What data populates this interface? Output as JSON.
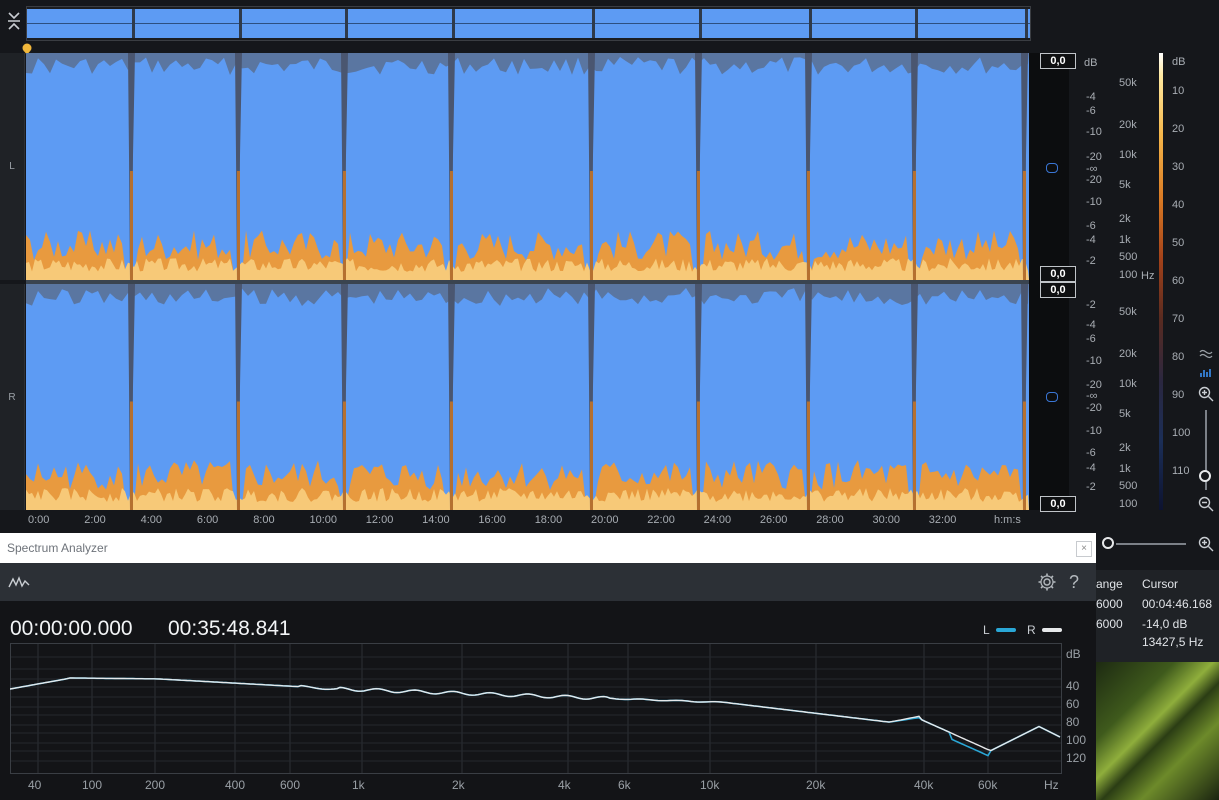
{
  "overview": {
    "collapse_icon": "collapse-icon"
  },
  "channels": {
    "left": "L",
    "right": "R"
  },
  "db_readouts": {
    "l_top": "0,0",
    "l_bottom": "0,0",
    "r_top": "0,0",
    "r_bottom": "0,0"
  },
  "amp_scale": {
    "unit": "dB",
    "left_ticks": [
      "-4",
      "-6",
      "-10",
      "-20",
      "-∞",
      "-20",
      "-10",
      "-6",
      "-4",
      "-2"
    ],
    "right_ticks": [
      "-2",
      "-4",
      "-6",
      "-10",
      "-20",
      "-∞",
      "-20",
      "-10",
      "-6",
      "-4",
      "-2"
    ]
  },
  "freq_scale": {
    "unit": "Hz",
    "left_ticks": [
      "50k",
      "20k",
      "10k",
      "5k",
      "2k",
      "1k",
      "500",
      "100"
    ],
    "right_ticks": [
      "50k",
      "20k",
      "10k",
      "5k",
      "2k",
      "1k",
      "500",
      "100"
    ]
  },
  "colorbar": {
    "unit": "dB",
    "ticks": [
      "10",
      "20",
      "30",
      "40",
      "50",
      "60",
      "70",
      "80",
      "90",
      "100",
      "110"
    ]
  },
  "timeline": {
    "ticks": [
      "0:00",
      "2:00",
      "4:00",
      "6:00",
      "8:00",
      "10:00",
      "12:00",
      "14:00",
      "16:00",
      "18:00",
      "20:00",
      "22:00",
      "24:00",
      "26:00",
      "28:00",
      "30:00",
      "32:00"
    ],
    "unit": "h:m:s"
  },
  "side_tools": {
    "waveform_icon": "waveform-view-icon",
    "spectro_icon": "spectrogram-view-icon",
    "zoom_in": "zoom-in-icon",
    "zoom_out": "zoom-out-icon"
  },
  "spectrum_analyzer": {
    "title": "Spectrum Analyzer",
    "start_time": "00:00:00.000",
    "end_time": "00:35:48.841",
    "legend_l": "L",
    "legend_r": "R",
    "y_unit": "dB",
    "y_ticks": [
      "40",
      "60",
      "80",
      "100",
      "120"
    ],
    "x_ticks": [
      "40",
      "100",
      "200",
      "400",
      "600",
      "1k",
      "2k",
      "4k",
      "6k",
      "10k",
      "20k",
      "40k",
      "60k",
      "Hz"
    ],
    "colors": {
      "L": "#2aa7d6",
      "R": "#e6e8ea"
    }
  },
  "info_panel": {
    "range_header": "ange",
    "cursor_header": "Cursor",
    "range_val1": "6000",
    "range_val2": "6000",
    "cursor_time": "00:04:46.168",
    "cursor_db": "-14,0 dB",
    "cursor_hz": "13427,5 Hz"
  }
}
